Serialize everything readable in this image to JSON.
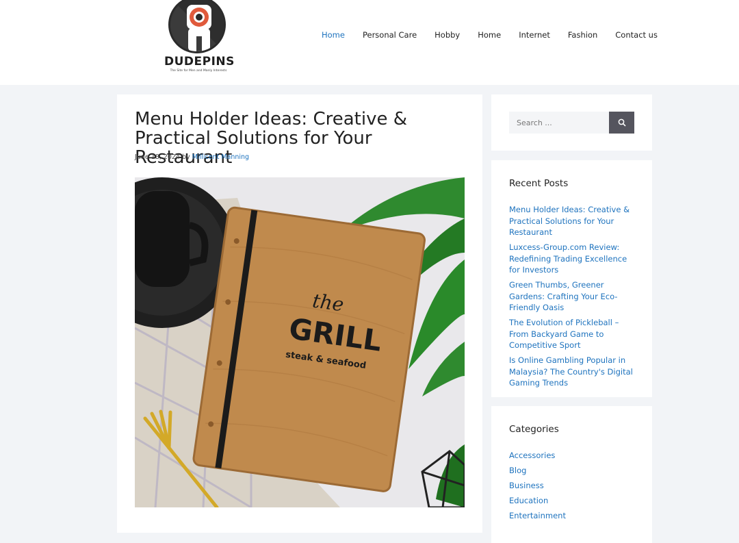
{
  "site": {
    "name": "DUDEPINS",
    "tagline": "The Site for Men and Manly Interests"
  },
  "nav": {
    "items": [
      {
        "label": "Home",
        "active": true
      },
      {
        "label": "Personal Care",
        "active": false
      },
      {
        "label": "Hobby",
        "active": false
      },
      {
        "label": "Home",
        "active": false
      },
      {
        "label": "Internet",
        "active": false
      },
      {
        "label": "Fashion",
        "active": false
      },
      {
        "label": "Contact us",
        "active": false
      }
    ]
  },
  "article": {
    "title": "Menu Holder Ideas: Creative & Practical Solutions for Your Restaurant",
    "date": "June 18, 2024",
    "by": "by",
    "author": "Millicent Manning",
    "image": {
      "alt": "Wooden menu holder",
      "menu_text_top": "the",
      "menu_text_main": "GRILL",
      "menu_text_sub": "steak & seafood"
    }
  },
  "search": {
    "placeholder": "Search ...",
    "icon": "search-icon"
  },
  "recent_posts": {
    "title": "Recent Posts",
    "items": [
      "Menu Holder Ideas: Creative & Practical Solutions for Your Restaurant",
      "Luxcess-Group.com Review: Redefining Trading Excellence for Investors",
      "Green Thumbs, Greener Gardens: Crafting Your Eco-Friendly Oasis",
      "The Evolution of Pickleball – From Backyard Game to Competitive Sport",
      "Is Online Gambling Popular in Malaysia? The Country's Digital Gaming Trends"
    ]
  },
  "categories": {
    "title": "Categories",
    "items": [
      "Accessories",
      "Blog",
      "Business",
      "Education",
      "Entertainment"
    ]
  },
  "colors": {
    "accent": "#1e73be",
    "background": "#f2f4f7",
    "search_button": "#55555e"
  }
}
